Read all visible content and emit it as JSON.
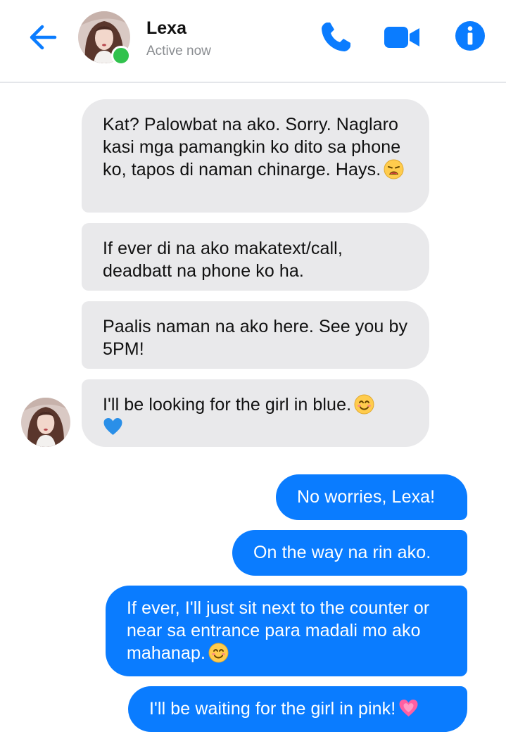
{
  "header": {
    "contact_name": "Lexa",
    "status": "Active now",
    "accent_color": "#0a7cff",
    "online_color": "#31c24d",
    "icons": [
      "back-arrow-icon",
      "phone-icon",
      "video-camera-icon",
      "info-icon"
    ]
  },
  "messages": [
    {
      "direction": "incoming",
      "text": "Kat? Palowbat na ako. Sorry. Naglaro kasi mga pamangkin ko dito sa phone ko, tapos di naman chinarge. Hays.",
      "emoji": "weary-face"
    },
    {
      "direction": "incoming",
      "text": "If ever di na ako makatext/call, deadbatt na phone ko ha."
    },
    {
      "direction": "incoming",
      "text": "Paalis naman na ako here. See you by 5PM!"
    },
    {
      "direction": "incoming",
      "text": "I'll be looking for the girl in blue.",
      "emoji": "smiling-face",
      "emoji_2": "blue-heart"
    },
    {
      "direction": "outgoing",
      "text": "No worries, Lexa!"
    },
    {
      "direction": "outgoing",
      "text": "On the way na rin ako."
    },
    {
      "direction": "outgoing",
      "text": "If ever, I'll just sit next to the counter or near sa entrance para madali mo ako mahanap.",
      "emoji": "smiling-face"
    },
    {
      "direction": "outgoing",
      "text": "I'll be waiting for the girl in pink!",
      "emoji": "growing-heart"
    }
  ],
  "colors": {
    "incoming_bubble": "#e9e9eb",
    "outgoing_bubble": "#0a7cff"
  }
}
